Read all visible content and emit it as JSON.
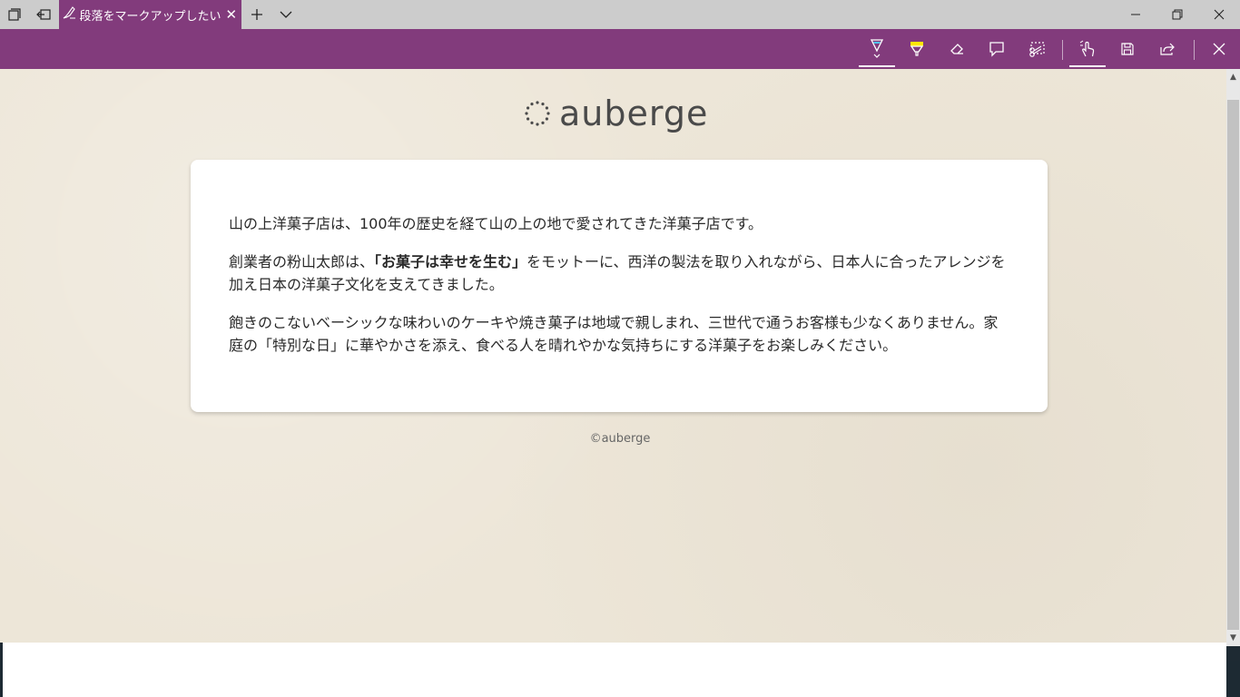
{
  "tab": {
    "title": "段落をマークアップしたい"
  },
  "icons": {
    "tab_actions": "tab-actions-icon",
    "set_aside": "set-aside-tabs-icon",
    "pen": "ballpoint-pen-icon",
    "new_tab": "plus-icon",
    "tab_list": "chevron-down-icon",
    "minimize": "minimize-icon",
    "restore": "restore-icon",
    "close": "close-icon"
  },
  "colors": {
    "accent": "#823b7c",
    "pen_color": "#4fc3f7",
    "highlighter_color": "#ffe600",
    "page_background": "#ede6d8"
  },
  "ink_toolbar": {
    "tools": [
      "ballpoint-pen",
      "highlighter",
      "eraser",
      "add-note",
      "clip",
      "touch-writing",
      "save",
      "share",
      "exit"
    ]
  },
  "page": {
    "logo_text": "auberge",
    "paragraphs": [
      {
        "text": "山の上洋菓子店は、100年の歴史を経て山の上の地で愛されてきた洋菓子店です。"
      },
      {
        "before": "創業者の粉山太郎は、",
        "strong": "「お菓子は幸せを生む」",
        "after": "をモットーに、西洋の製法を取り入れながら、日本人に合ったアレンジを加え日本の洋菓子文化を支えてきました。"
      },
      {
        "text": "飽きのこないベーシックな味わいのケーキや焼き菓子は地域で親しまれ、三世代で通うお客様も少なくありません。家庭の「特別な日」に華やかさを添え、食べる人を晴れやかな気持ちにする洋菓子をお楽しみください。"
      }
    ],
    "copyright": "©auberge"
  }
}
